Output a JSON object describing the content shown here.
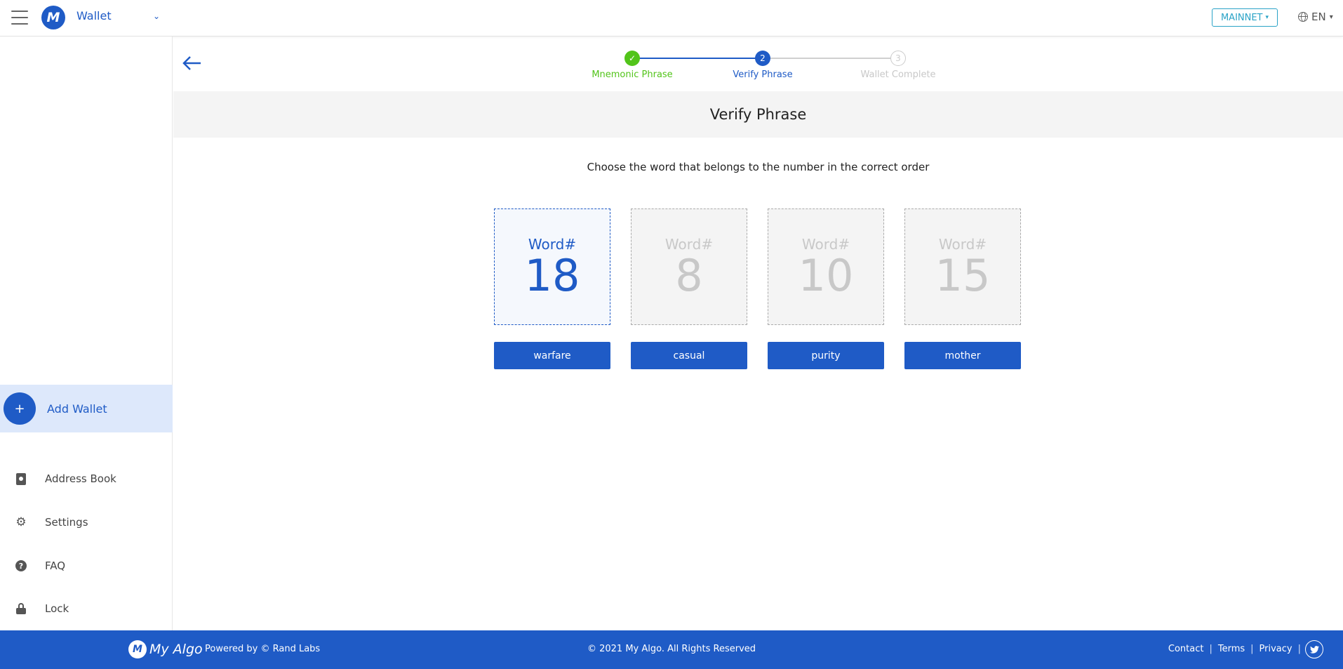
{
  "header": {
    "logo_letter": "M",
    "wallet_title": "Wallet",
    "network": "MAINNET",
    "language": "EN"
  },
  "sidebar": {
    "add_wallet": "Add Wallet",
    "items": [
      {
        "label": "Address Book",
        "icon": "address-book-icon"
      },
      {
        "label": "Settings",
        "icon": "gear-icon"
      },
      {
        "label": "FAQ",
        "icon": "question-icon"
      },
      {
        "label": "Lock",
        "icon": "lock-icon"
      }
    ]
  },
  "stepper": {
    "steps": [
      {
        "label": "Mnemonic Phrase",
        "state": "complete"
      },
      {
        "label": "Verify Phrase",
        "number": "2",
        "state": "active"
      },
      {
        "label": "Wallet Complete",
        "number": "3",
        "state": "pending"
      }
    ]
  },
  "main": {
    "title": "Verify Phrase",
    "instruction": "Choose the word that belongs to the number in the correct order",
    "word_label": "Word#",
    "cards": [
      {
        "number": "18",
        "active": true
      },
      {
        "number": "8",
        "active": false
      },
      {
        "number": "10",
        "active": false
      },
      {
        "number": "15",
        "active": false
      }
    ],
    "choices": [
      "warfare",
      "casual",
      "purity",
      "mother"
    ]
  },
  "footer": {
    "brand": "My Algo",
    "powered": "Powered by  © Rand Labs",
    "copyright": "© 2021 My Algo.  All Rights Reserved",
    "links": [
      "Contact",
      "Terms",
      "Privacy"
    ]
  },
  "colors": {
    "primary": "#1f5bc6",
    "success": "#52c41a",
    "muted": "#c8c8c8",
    "network": "#2aa3c7"
  }
}
